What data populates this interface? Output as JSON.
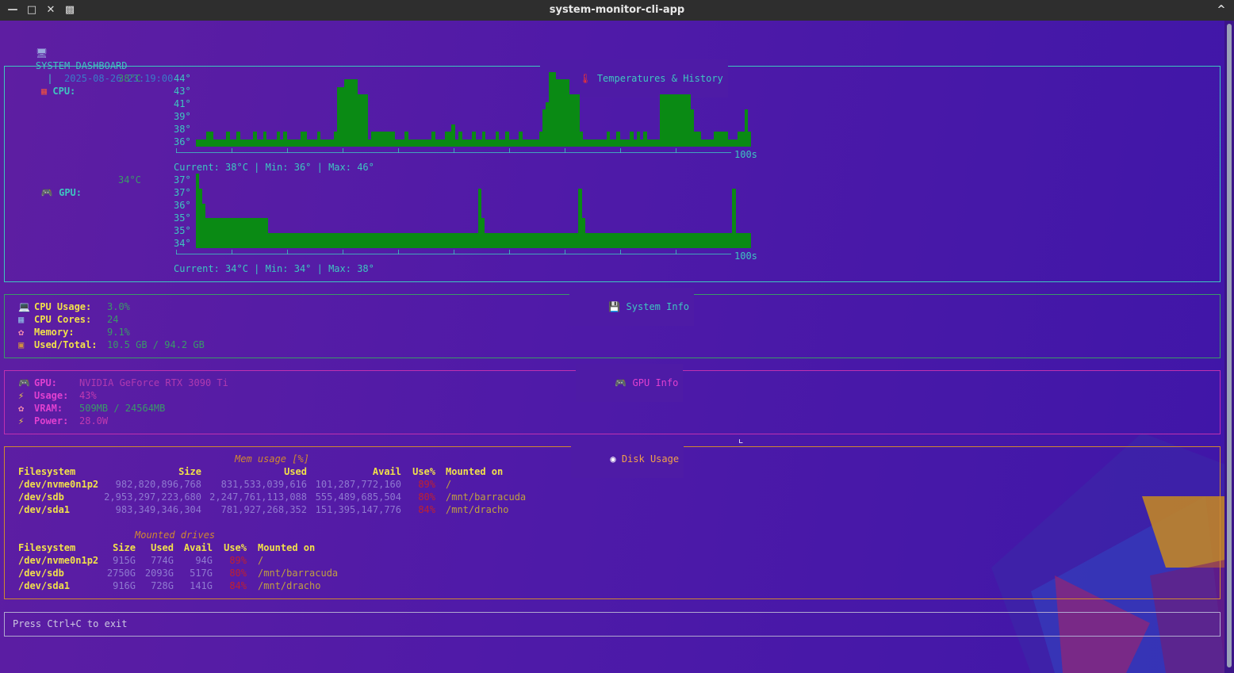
{
  "window": {
    "title": "system-monitor-cli-app"
  },
  "header": {
    "icon": "monitor-icon",
    "title": "SYSTEM DASHBOARD",
    "separator": "|",
    "timestamp": "2025-08-26 23:19:00"
  },
  "temps": {
    "panel_title": "Temperatures & History",
    "title_icon": "thermometer-icon",
    "cpu": {
      "label": "CPU:",
      "icon": "cpu-chip-icon",
      "current": "38°C",
      "y_ticks": [
        "44°",
        "43°",
        "41°",
        "39°",
        "38°",
        "36°"
      ],
      "x_end_label": "100s",
      "summary": "Current: 38°C | Min: 36° | Max: 46°",
      "history": [
        38,
        38,
        37,
        37,
        37,
        37,
        37,
        37,
        37,
        37,
        37,
        37,
        37,
        37,
        37,
        38,
        37,
        37,
        37,
        37,
        37,
        37,
        38,
        38,
        37,
        37,
        37,
        38,
        37,
        37,
        37,
        37,
        37,
        38,
        37,
        37,
        37,
        37,
        37,
        37,
        37,
        38,
        37,
        37,
        37,
        37,
        37,
        37,
        37,
        38,
        37,
        37,
        37,
        38,
        37,
        37,
        37,
        38,
        37,
        37,
        37,
        37,
        38,
        38,
        37,
        37,
        37,
        37,
        37,
        37,
        37,
        37,
        37,
        37,
        38,
        37,
        37,
        37,
        37,
        37,
        37,
        37,
        37,
        38,
        38,
        38,
        38,
        38,
        38,
        38,
        37,
        37,
        37,
        38,
        37,
        37,
        37,
        37,
        37,
        37,
        37,
        37,
        37,
        37,
        37,
        37,
        37,
        37,
        37,
        37,
        37,
        37,
        37,
        37,
        37,
        37,
        37,
        37,
        37,
        37,
        37,
        37,
        37,
        37,
        37,
        37,
        38,
        37,
        37,
        37,
        37,
        37,
        37,
        37,
        37,
        37,
        37,
        37,
        37,
        37,
        37,
        37,
        37,
        37,
        37,
        37,
        37,
        37,
        37,
        37,
        37,
        37,
        37,
        37,
        37,
        37,
        37,
        37,
        37,
        37,
        37,
        37,
        37,
        37,
        37,
        37,
        37,
        37,
        37,
        37,
        37,
        37,
        37,
        37,
        37,
        37,
        37,
        37,
        37,
        37,
        37,
        37,
        37,
        37,
        37,
        37,
        37,
        37,
        37,
        37,
        37,
        37,
        37,
        37,
        37,
        37,
        37,
        37,
        37,
        37,
        37,
        37,
        37,
        37,
        37,
        37,
        37,
        37,
        37,
        37,
        37,
        37,
        37,
        37,
        37,
        37,
        37,
        37,
        37,
        37,
        37,
        37,
        37,
        37,
        37,
        37,
        37,
        37,
        37,
        37,
        37,
        37,
        37,
        37,
        37,
        37,
        37,
        37,
        37,
        37,
        37,
        37,
        37,
        37,
        37,
        37,
        37,
        37,
        37,
        37,
        37,
        37,
        37,
        37,
        37,
        37,
        37,
        37,
        37,
        37,
        37,
        37,
        37,
        37,
        37,
        37,
        37,
        37,
        37,
        37,
        37,
        37,
        37,
        37,
        37,
        37,
        37,
        37,
        37,
        37,
        37,
        37,
        37,
        37,
        37,
        37,
        37,
        37,
        37,
        37,
        37,
        37,
        37,
        37,
        37,
        37,
        37,
        37,
        37,
        37,
        37,
        37,
        37,
        37,
        37,
        37,
        37,
        37,
        37,
        37,
        37,
        37,
        37,
        37,
        37,
        37,
        37,
        37,
        37,
        37,
        37,
        37,
        37,
        37,
        37,
        37,
        37,
        37,
        37,
        37,
        37,
        37,
        37,
        37,
        37,
        37,
        37,
        37,
        37,
        37,
        37,
        37,
        37,
        37,
        37,
        37,
        37,
        37,
        37,
        37,
        37,
        37,
        37,
        37,
        37,
        37,
        37,
        37,
        37,
        37,
        37,
        37,
        37,
        37,
        37,
        37,
        37,
        37,
        37,
        37,
        37,
        37,
        37,
        37,
        37,
        37,
        37,
        37,
        37,
        37,
        37,
        37,
        37,
        37,
        37,
        37,
        37,
        37,
        37,
        37,
        37,
        37,
        37,
        37,
        37,
        37,
        37,
        37,
        37,
        37,
        37,
        37,
        37,
        37,
        37,
        37,
        37,
        37,
        37,
        37,
        37,
        37,
        37,
        37,
        37,
        37,
        37,
        37,
        37,
        37,
        37,
        37,
        37,
        37,
        37,
        37,
        37,
        37,
        37,
        37,
        37,
        37,
        37,
        37,
        37,
        37,
        37,
        37,
        37,
        37,
        37,
        37,
        37,
        37,
        37,
        37,
        37,
        37,
        37,
        37,
        37,
        37,
        37,
        37,
        37,
        37,
        37,
        37,
        37,
        37,
        37,
        37,
        37,
        37,
        37,
        37,
        37,
        37,
        37,
        37,
        37,
        37,
        37,
        37,
        37,
        37,
        37,
        37,
        37,
        37,
        37,
        37,
        37,
        37,
        37,
        37,
        37,
        37,
        37,
        37,
        37,
        37,
        37,
        37,
        37,
        37,
        37,
        37,
        37,
        37,
        37,
        37,
        37,
        37,
        37,
        37,
        37,
        37,
        37,
        37,
        37,
        37,
        37,
        37,
        37,
        37,
        37,
        37,
        37,
        37,
        37,
        37,
        37,
        37,
        37,
        37,
        37,
        37,
        37,
        37,
        37,
        37,
        37,
        37,
        37,
        37,
        37,
        37,
        37,
        37,
        37,
        37,
        37,
        37,
        37,
        37,
        37,
        37,
        37,
        37,
        37,
        37,
        37,
        37,
        37,
        37,
        37,
        37,
        37,
        37,
        37,
        37,
        37,
        37,
        37,
        37,
        37,
        37,
        37,
        37,
        37,
        37,
        37,
        37,
        37,
        37,
        37,
        37,
        37,
        37,
        37,
        37,
        37,
        37,
        37,
        37,
        37,
        37,
        37,
        37,
        37,
        37,
        37,
        37
      ]
    },
    "gpu": {
      "label": "GPU:",
      "icon": "gamepad-icon",
      "current": "34°C",
      "y_ticks": [
        "37°",
        "37°",
        "36°",
        "35°",
        "35°",
        "34°"
      ],
      "x_end_label": "100s",
      "summary": "Current: 34°C | Min: 34° | Max: 38°"
    }
  },
  "chart_data": [
    {
      "type": "bar",
      "name": "CPU temperature history",
      "ylabel": "",
      "y_ticks": [
        "44°",
        "43°",
        "41°",
        "39°",
        "38°",
        "36°"
      ],
      "x_end_label": "100s",
      "values": [
        37,
        37,
        37,
        38,
        38,
        37,
        37,
        37,
        37,
        38,
        37,
        37,
        38,
        37,
        37,
        37,
        37,
        38,
        37,
        37,
        38,
        37,
        37,
        37,
        38,
        37,
        38,
        37,
        37,
        37,
        37,
        38,
        38,
        37,
        37,
        37,
        38,
        37,
        37,
        37,
        37,
        38,
        44,
        44,
        45,
        45,
        45,
        45,
        43,
        43,
        43,
        37,
        38,
        38,
        38,
        38,
        38,
        38,
        38,
        37,
        37,
        37,
        38,
        37,
        37,
        37,
        37,
        37,
        37,
        37,
        38,
        37,
        37,
        37,
        38,
        38,
        39,
        37,
        38,
        37,
        37,
        37,
        38,
        37,
        37,
        38,
        37,
        37,
        37,
        38,
        37,
        37,
        38,
        37,
        37,
        37,
        38,
        37,
        37,
        37,
        37,
        37,
        38,
        41,
        42,
        46,
        46,
        45,
        45,
        45,
        45,
        43,
        43,
        43,
        38,
        37,
        37,
        37,
        37,
        37,
        37,
        37,
        38,
        37,
        37,
        38,
        37,
        37,
        37,
        38,
        37,
        38,
        37,
        38,
        37,
        37,
        37,
        37,
        43,
        43,
        43,
        43,
        43,
        43,
        43,
        43,
        43,
        41,
        38,
        38,
        37,
        37,
        37,
        37,
        38,
        38,
        38,
        38,
        37,
        37,
        37,
        38,
        38,
        41,
        38
      ]
    },
    {
      "type": "bar",
      "name": "GPU temperature history",
      "y_ticks": [
        "37°",
        "37°",
        "36°",
        "35°",
        "35°",
        "34°"
      ],
      "x_end_label": "100s",
      "values": [
        38,
        37,
        36,
        35,
        35,
        35,
        35,
        35,
        35,
        35,
        35,
        35,
        35,
        35,
        35,
        35,
        35,
        35,
        35,
        35,
        35,
        35,
        35,
        34,
        34,
        34,
        34,
        34,
        34,
        34,
        34,
        34,
        34,
        34,
        34,
        34,
        34,
        34,
        34,
        34,
        34,
        34,
        34,
        34,
        34,
        34,
        34,
        34,
        34,
        34,
        34,
        34,
        34,
        34,
        34,
        34,
        34,
        34,
        34,
        34,
        34,
        34,
        34,
        34,
        34,
        34,
        34,
        34,
        34,
        34,
        34,
        34,
        34,
        34,
        34,
        34,
        34,
        34,
        34,
        34,
        34,
        34,
        34,
        34,
        34,
        34,
        34,
        34,
        34,
        34,
        37,
        35,
        34,
        34,
        34,
        34,
        34,
        34,
        34,
        34,
        34,
        34,
        34,
        34,
        34,
        34,
        34,
        34,
        34,
        34,
        34,
        34,
        34,
        34,
        34,
        34,
        34,
        34,
        34,
        34,
        34,
        34,
        37,
        35,
        34,
        34,
        34,
        34,
        34,
        34,
        34,
        34,
        34,
        34,
        34,
        34,
        34,
        34,
        34,
        34,
        34,
        34,
        34,
        34,
        34,
        34,
        34,
        34,
        34,
        34,
        34,
        34,
        34,
        34,
        34,
        34,
        34,
        34,
        34,
        34,
        34,
        34,
        34,
        34,
        34,
        34,
        34,
        34,
        34,
        34,
        34,
        37,
        34,
        34,
        34,
        34,
        34
      ]
    }
  ],
  "system_info": {
    "panel_title": "System Info",
    "title_icon": "floppy-disk-icon",
    "rows": [
      {
        "icon": "computer-icon",
        "label": "CPU Usage:",
        "value": "3.0%"
      },
      {
        "icon": "abacus-icon",
        "label": "CPU Cores:",
        "value": "24"
      },
      {
        "icon": "brain-icon",
        "label": "Memory:",
        "value": "9.1%"
      },
      {
        "icon": "package-icon",
        "label": "Used/Total:",
        "value": "10.5 GB / 94.2 GB"
      }
    ]
  },
  "gpu_info": {
    "panel_title": "GPU Info",
    "title_icon": "gamepad-icon",
    "rows": [
      {
        "icon": "gamepad-icon",
        "label": "GPU:",
        "value": "NVIDIA GeForce RTX 3090 Ti"
      },
      {
        "icon": "lightning-icon",
        "label": "Usage:",
        "value": "43%"
      },
      {
        "icon": "brain-icon",
        "label": "VRAM:",
        "value": "509MB / 24564MB"
      },
      {
        "icon": "lightning-icon",
        "label": "Power:",
        "value": "28.0W"
      }
    ]
  },
  "disk": {
    "panel_title": "Disk Usage",
    "title_icon": "disc-icon",
    "table1": {
      "caption": "Mem usage [%]",
      "headers": [
        "Filesystem",
        "Size",
        "Used",
        "Avail",
        "Use%",
        "Mounted on"
      ],
      "rows": [
        [
          "/dev/nvme0n1p2",
          "982,820,896,768",
          "831,533,039,616",
          "101,287,772,160",
          "89%",
          "/"
        ],
        [
          "/dev/sdb",
          "2,953,297,223,680",
          "2,247,761,113,088",
          "555,489,685,504",
          "80%",
          "/mnt/barracuda"
        ],
        [
          "/dev/sda1",
          "983,349,346,304",
          "781,927,268,352",
          "151,395,147,776",
          "84%",
          "/mnt/dracho"
        ]
      ]
    },
    "table2": {
      "caption": "Mounted drives",
      "headers": [
        "Filesystem",
        "Size",
        "Used",
        "Avail",
        "Use%",
        "Mounted on"
      ],
      "rows": [
        [
          "/dev/nvme0n1p2",
          "915G",
          "774G",
          "94G",
          "89%",
          "/"
        ],
        [
          "/dev/sdb",
          "2750G",
          "2093G",
          "517G",
          "80%",
          "/mnt/barracuda"
        ],
        [
          "/dev/sda1",
          "916G",
          "728G",
          "141G",
          "84%",
          "/mnt/dracho"
        ]
      ]
    }
  },
  "footer": {
    "hint": "Press Ctrl+C to exit"
  },
  "colors": {
    "cyan": "#3ec6c0",
    "green_bar": "#0a8a14",
    "magenta": "#e040d0",
    "yellow": "#f1e04a",
    "red": "#c02030",
    "orange_border": "#d08830"
  }
}
